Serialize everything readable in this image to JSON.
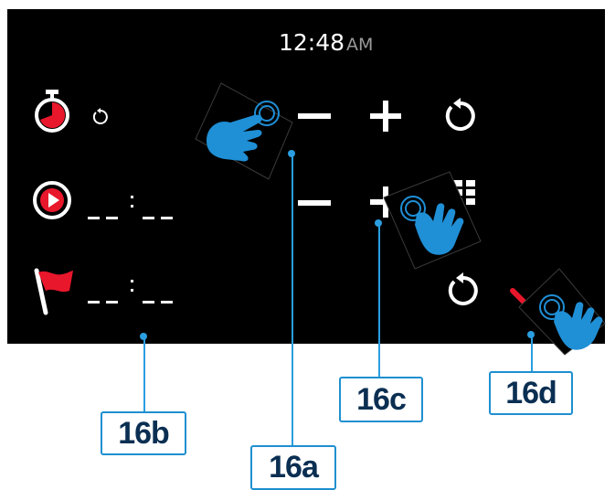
{
  "screen": {
    "time": "12:48",
    "ampm": "AM"
  },
  "rows": [
    {
      "name": "timer",
      "icon": "timer-icon",
      "value_icon": "reset-icon"
    },
    {
      "name": "start",
      "icon": "play-icon",
      "value": "--:--"
    },
    {
      "name": "finish",
      "icon": "flag-icon",
      "value": "--:--"
    }
  ],
  "controls": {
    "row1": [
      "minus-icon",
      "plus-icon",
      "reset-icon"
    ],
    "row2": [
      "minus-icon",
      "plus-icon",
      "keypad-icon"
    ],
    "row3": [
      "reset-icon",
      "confirm-check-icon"
    ]
  },
  "callouts": {
    "a": "16a",
    "b": "16b",
    "c": "16c",
    "d": "16d"
  },
  "colors": {
    "accent": "#e8172b",
    "callout_border": "#1e8fd0",
    "callout_text": "#0b2f52",
    "hand": "#1f8fd6"
  }
}
